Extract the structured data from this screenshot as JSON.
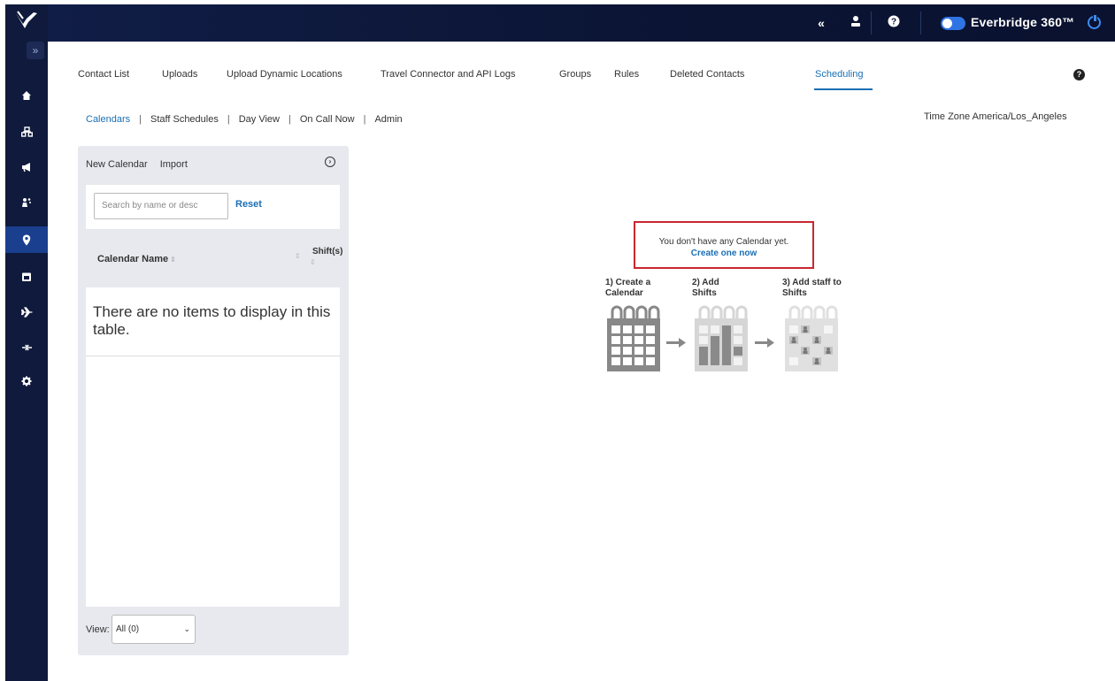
{
  "topbar": {
    "brand": "Everbridge 360™",
    "icons": [
      "collapse-left-icon",
      "user-icon",
      "help-icon",
      "toggle-icon",
      "power-icon"
    ]
  },
  "rail": {
    "expand_label": "»",
    "icons": [
      "home-icon",
      "organization-icon",
      "megaphone-icon",
      "people-icon",
      "location-icon",
      "calendar-icon",
      "plane-icon",
      "integration-icon",
      "settings-icon"
    ]
  },
  "tabs": {
    "items": [
      {
        "label": "Contact List"
      },
      {
        "label": "Uploads"
      },
      {
        "label": "Upload Dynamic Locations"
      },
      {
        "label": "Travel Connector and API Logs"
      },
      {
        "label": "Groups"
      },
      {
        "label": "Rules"
      },
      {
        "label": "Deleted Contacts"
      },
      {
        "label": "Scheduling",
        "active": true
      }
    ]
  },
  "subnav": {
    "items": [
      "Calendars",
      "Staff Schedules",
      "Day View",
      "On Call Now",
      "Admin"
    ],
    "separator": "|"
  },
  "timezone": "Time Zone America/Los_Angeles",
  "panel": {
    "new_calendar": "New Calendar",
    "import": "Import",
    "search_placeholder": "Search by name or desc",
    "reset": "Reset",
    "col_name": "Calendar Name",
    "col_shifts": "Shift(s)",
    "empty": "There are no items to display in this table.",
    "view_label": "View:",
    "view_value": "All (0)"
  },
  "notice": {
    "line1": "You don't have any Calendar yet.",
    "link": "Create one now"
  },
  "steps": [
    {
      "label": "1) Create a Calendar"
    },
    {
      "label": "2) Add Shifts"
    },
    {
      "label": "3) Add staff to Shifts"
    }
  ]
}
